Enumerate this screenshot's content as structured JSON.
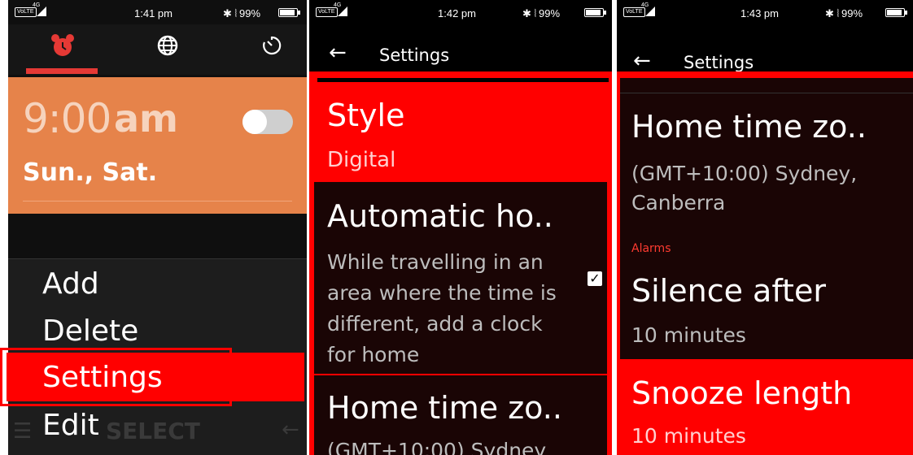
{
  "screen1": {
    "status": {
      "network": "VoLTE",
      "signal": "4G",
      "time": "1:41 pm",
      "battery": "99%"
    },
    "tabs": [
      {
        "icon": "alarm-clock-icon",
        "active": true
      },
      {
        "icon": "globe-icon",
        "active": false
      },
      {
        "icon": "timer-icon",
        "active": false
      }
    ],
    "alarm": {
      "time": "9:00",
      "ampm": "am",
      "days": "Sun., Sat.",
      "enabled": false
    },
    "menu": {
      "items": [
        "Add",
        "Delete",
        "Settings",
        "Edit"
      ],
      "selected": "Settings"
    },
    "softkeys": {
      "center": "SELECT"
    },
    "colors": {
      "alarm_card": "#e6834a",
      "highlight": "#ff0000",
      "tab_accent": "#e53935"
    }
  },
  "screen2": {
    "status": {
      "network": "VoLTE",
      "signal": "4G",
      "time": "1:42 pm",
      "battery": "99%"
    },
    "title": "Settings",
    "items": [
      {
        "title": "Style",
        "subtitle": "Digital",
        "selected": true
      },
      {
        "title": "Automatic ho..",
        "description": "While travelling in an area where the time is different, add a clock for home",
        "checked": true
      },
      {
        "title": "Home time zo..",
        "subtitle": "(GMT+10:00) Sydney"
      }
    ]
  },
  "screen3": {
    "status": {
      "network": "VoLTE",
      "signal": "4G",
      "time": "1:43 pm",
      "battery": "99%"
    },
    "title": "Settings",
    "items": [
      {
        "title": "Home time zo..",
        "subtitle": "(GMT+10:00) Sydney, Canberra"
      },
      {
        "section": "Alarms"
      },
      {
        "title": "Silence after",
        "subtitle": "10 minutes"
      },
      {
        "title": "Snooze length",
        "subtitle": "10 minutes",
        "selected": true
      }
    ]
  }
}
